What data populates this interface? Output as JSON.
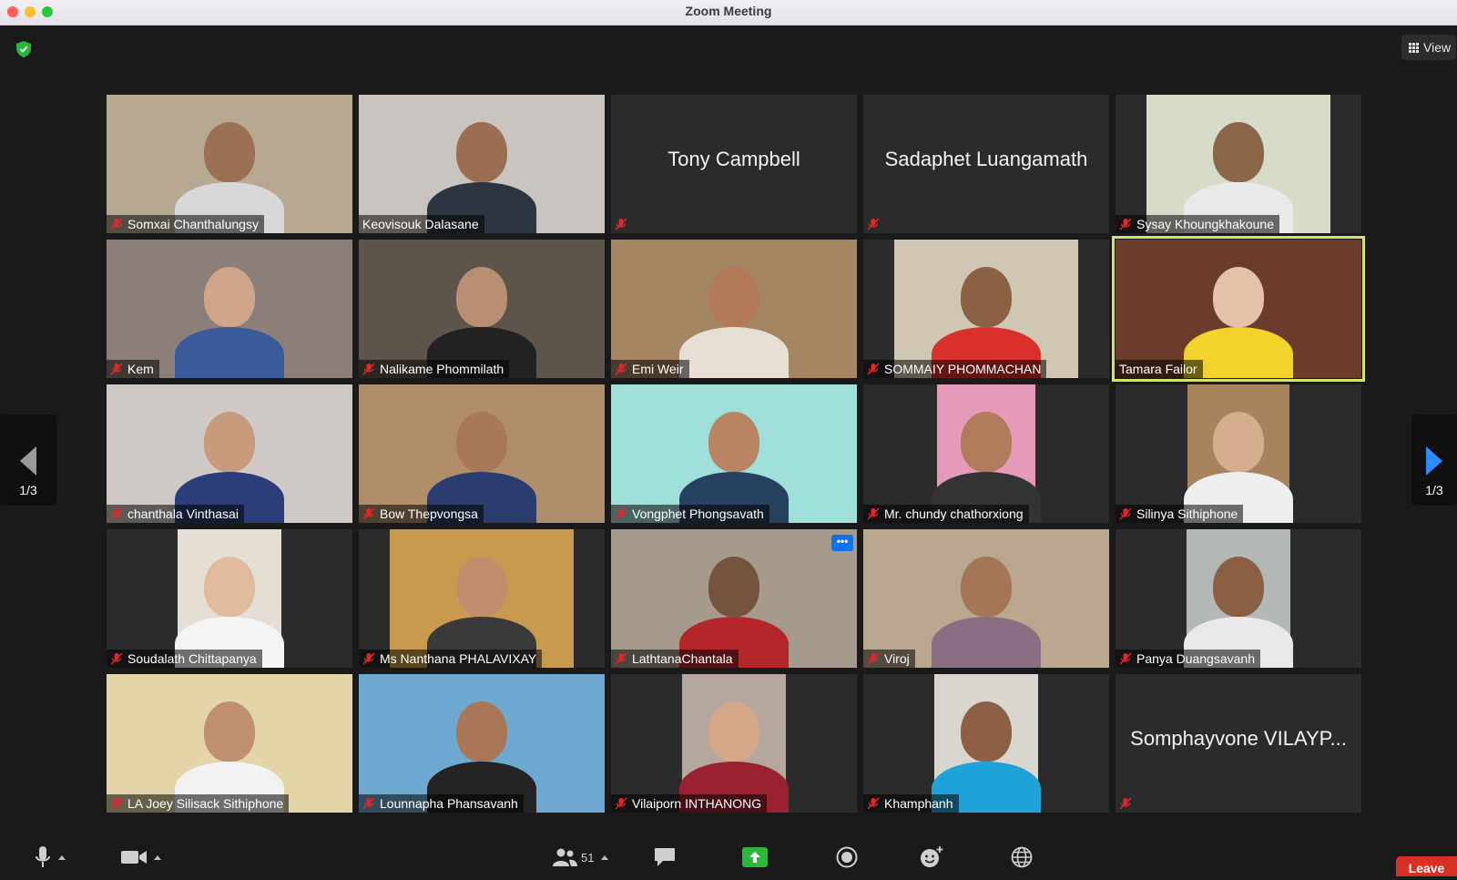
{
  "window": {
    "title": "Zoom Meeting"
  },
  "view_button": {
    "label": "View"
  },
  "pager": {
    "left_label": "1/3",
    "right_label": "1/3"
  },
  "participants": [
    {
      "name": "Somxai Chanthalungsy",
      "video": true,
      "muted": true,
      "bg": "#b7a892",
      "skin": "#9a7155",
      "shirt": "#d8d8d8",
      "vw": 270
    },
    {
      "name": "Keovisouk Dalasane",
      "video": true,
      "muted": false,
      "bg": "#c9c4bf",
      "skin": "#9b6e53",
      "shirt": "#2d3640",
      "vw": 270
    },
    {
      "name": "Tony Campbell",
      "video": false,
      "muted": true,
      "show_name": true
    },
    {
      "name": "Sadaphet Luangamath",
      "video": false,
      "muted": true,
      "show_name": true
    },
    {
      "name": "Sysay Khoungkhakoune",
      "video": true,
      "muted": true,
      "bg": "#d7dcc9",
      "skin": "#8c6648",
      "shirt": "#e9e9e9",
      "vw": 202
    },
    {
      "name": "Kem",
      "video": true,
      "muted": true,
      "bg": "#8c7f79",
      "skin": "#cfa689",
      "shirt": "#3b5a9a",
      "vw": 270
    },
    {
      "name": "Nalikame Phommilath",
      "video": true,
      "muted": true,
      "bg": "#5d544b",
      "skin": "#b88f72",
      "shirt": "#222",
      "vw": 270
    },
    {
      "name": "Emi Weir",
      "video": true,
      "muted": true,
      "bg": "#a48663",
      "skin": "#b27a59",
      "shirt": "#e7dfd6",
      "vw": 270
    },
    {
      "name": "SOMMAIY PHOMMACHAN",
      "video": true,
      "muted": true,
      "bg": "#cfc6b4",
      "skin": "#8a6142",
      "shirt": "#d9302b",
      "vw": 202
    },
    {
      "name": "Tamara Failor",
      "video": true,
      "muted": false,
      "active": true,
      "bg": "#6b3b2c",
      "skin": "#e4c1a8",
      "shirt": "#f2d32b",
      "vw": 270
    },
    {
      "name": "chanthala Vinthasai",
      "video": true,
      "muted": true,
      "bg": "#cfcac6",
      "skin": "#c79a7c",
      "shirt": "#2c3e7a",
      "vw": 270
    },
    {
      "name": "Bow Thepvongsa",
      "video": true,
      "muted": true,
      "bg": "#b08e6c",
      "skin": "#a9775a",
      "shirt": "#2b3c6e",
      "vw": 270
    },
    {
      "name": "Vongphet Phongsavath",
      "video": true,
      "muted": true,
      "bg": "#9fe0db",
      "skin": "#b88462",
      "shirt": "#26405f",
      "vw": 270
    },
    {
      "name": "Mr. chundy chathorxiong",
      "video": true,
      "muted": true,
      "bg": "#e59ab9",
      "skin": "#b07c5c",
      "shirt": "#333",
      "vw": 108
    },
    {
      "name": "Silinya Sithiphone",
      "video": true,
      "muted": true,
      "bg": "#a7845e",
      "skin": "#d7ad90",
      "shirt": "#eeeeee",
      "vw": 112
    },
    {
      "name": "Soudalath Chittapanya",
      "video": true,
      "muted": true,
      "bg": "#e5ded4",
      "skin": "#e1bb9d",
      "shirt": "#f5f5f5",
      "vw": 114
    },
    {
      "name": "Ms Nanthana PHALAVIXAY",
      "video": true,
      "muted": true,
      "bg": "#c79a4d",
      "skin": "#c08d6f",
      "shirt": "#3a3a3a",
      "vw": 202
    },
    {
      "name": "LathtanaChantala",
      "video": true,
      "muted": true,
      "more": true,
      "bg": "#a59a8b",
      "skin": "#74543f",
      "shirt": "#b5262a",
      "vw": 270
    },
    {
      "name": "Viroj",
      "video": true,
      "muted": true,
      "bg": "#b9a78f",
      "skin": "#a57557",
      "shirt": "#8a6e83",
      "vw": 270
    },
    {
      "name": "Panya Duangsavanh",
      "video": true,
      "muted": true,
      "bg": "#b4b8b7",
      "skin": "#8b5f43",
      "shirt": "#e9e9e9",
      "vw": 114
    },
    {
      "name": "LA Joey Silisack Sithiphone",
      "video": true,
      "muted": true,
      "bg": "#e3d5a7",
      "skin": "#c09070",
      "shirt": "#f2f2f2",
      "vw": 270
    },
    {
      "name": "Lounnapha Phansavanh",
      "video": true,
      "muted": true,
      "bg": "#6fa8d0",
      "skin": "#a97658",
      "shirt": "#232323",
      "vw": 270
    },
    {
      "name": "Vilaiporn INTHANONG",
      "video": true,
      "muted": true,
      "bg": "#b5a69e",
      "skin": "#d4a889",
      "shirt": "#9a2230",
      "vw": 114
    },
    {
      "name": "Khamphanh",
      "video": true,
      "muted": true,
      "bg": "#d8d6cf",
      "skin": "#8d6046",
      "shirt": "#1ea2d7",
      "vw": 114
    },
    {
      "name": "Somphayvone VILAYP...",
      "video": false,
      "muted": true,
      "show_name": true,
      "hide_label": true
    }
  ],
  "toolbar": {
    "participants_count": "51",
    "leave_label": "Leave"
  },
  "icons": [
    "shield-icon",
    "grid-view-icon",
    "mic-off-icon",
    "mic-icon",
    "video-camera-icon",
    "participants-icon",
    "chat-icon",
    "share-screen-icon",
    "record-icon",
    "reactions-icon",
    "globe-icon",
    "more-options-icon",
    "arrow-left-icon",
    "arrow-right-icon"
  ],
  "colors": {
    "active_speaker": "#d4e36a",
    "share_green": "#2ab73b",
    "leave_red": "#d93025",
    "accent_blue": "#0e72ed"
  }
}
